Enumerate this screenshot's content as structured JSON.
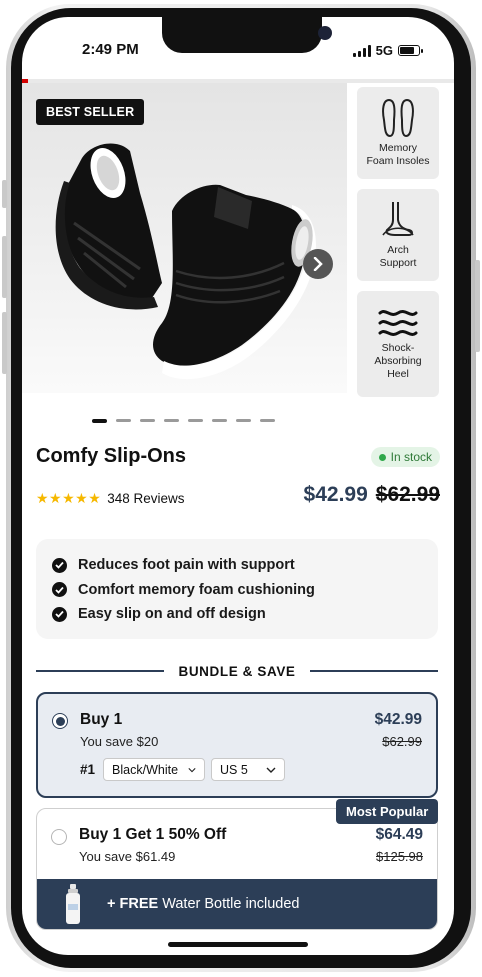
{
  "status_bar": {
    "time": "2:49 PM",
    "network": "5G"
  },
  "product": {
    "badge": "BEST SELLER",
    "title": "Comfy Slip-Ons",
    "stock": "In stock",
    "rating_stars": 5,
    "reviews": "348 Reviews",
    "price": "$42.99",
    "compare_price": "$62.99",
    "image_count": 8,
    "active_image": 1
  },
  "features": [
    {
      "icon": "insoles-icon",
      "label": "Memory\nFoam Insoles"
    },
    {
      "icon": "arch-foot-icon",
      "label": "Arch\nSupport"
    },
    {
      "icon": "waves-icon",
      "label": "Shock-\nAbsorbing\nHeel"
    }
  ],
  "benefits": [
    "Reduces foot pain with support",
    "Comfort memory foam cushioning",
    "Easy slip on and off design"
  ],
  "bundle": {
    "heading": "BUNDLE & SAVE",
    "offers": [
      {
        "name": "Buy 1",
        "save": "You save $20",
        "price": "$42.99",
        "old": "$62.99",
        "item_num": "#1",
        "color": "Black/White",
        "size": "US 5",
        "selected": true
      },
      {
        "name": "Buy 1 Get 1 50% Off",
        "save": "You save $61.49",
        "price": "$64.49",
        "old": "$125.98",
        "tag": "Most Popular",
        "selected": false
      }
    ],
    "free_bonus_strong": "+ FREE",
    "free_bonus_rest": " Water Bottle included"
  },
  "colors": {
    "navy": "#2c3e57",
    "star": "#f6b800",
    "stock_green": "#2fa84a"
  }
}
